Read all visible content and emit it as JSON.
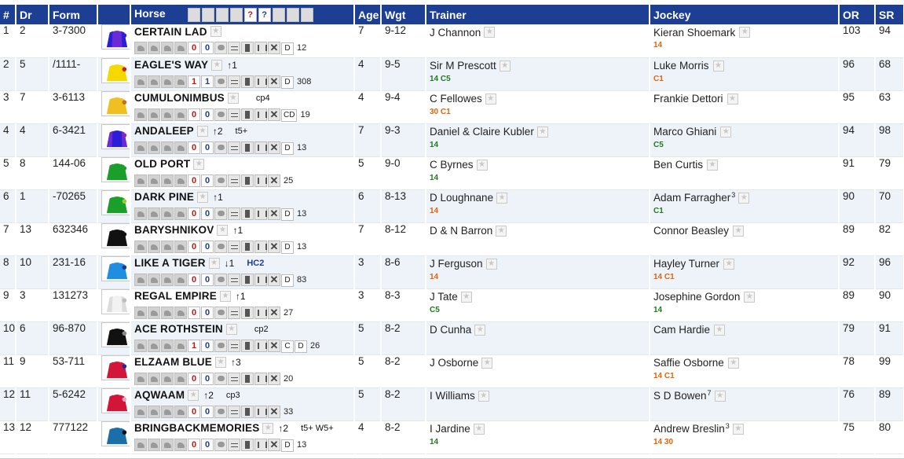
{
  "columns": {
    "num": "#",
    "dr": "Dr",
    "form": "Form",
    "horse": "Horse",
    "age": "Age",
    "wgt": "Wgt",
    "trainer": "Trainer",
    "jockey": "Jockey",
    "or": "OR",
    "sr": "SR"
  },
  "header_icons": {
    "q1": "?",
    "q2": "?"
  },
  "colors": {
    "header_bg": "#1c3f94",
    "row_alt_bg": "#eef3f9",
    "stat_green": "#1f7a1f",
    "stat_orange": "#e0650b",
    "count_red": "#c61616",
    "count_blue": "#1c3f94"
  },
  "runners": [
    {
      "num": "1",
      "dr": "2",
      "form": "3-7300",
      "name": "CERTAIN LAD",
      "trend": "",
      "tag": "",
      "c1": "0",
      "c2": "0",
      "code": "D",
      "rating": "12",
      "age": "7",
      "wgt": "9-12",
      "trainer": "J Channon",
      "trainer_claim": "",
      "trainer_stat": "",
      "jockey": "Kieran Shoemark",
      "jockey_claim": "",
      "jockey_stat": "14",
      "jockey_stat_color": "orange",
      "trainer_stat_color": "",
      "or": "103",
      "sr": "94",
      "silk": {
        "body": "#6a2bd6",
        "sleeve": "#2a1fd6",
        "cap": "#2a1fd6"
      }
    },
    {
      "num": "2",
      "dr": "5",
      "form": "/1111-",
      "name": "EAGLE'S WAY",
      "trend": "↑1",
      "tag": "",
      "c1": "1",
      "c2": "1",
      "code": "D",
      "rating": "308",
      "age": "4",
      "wgt": "9-5",
      "trainer": "Sir M Prescott",
      "trainer_claim": "",
      "trainer_stat": "14 C5",
      "trainer_stat_color": "green",
      "jockey": "Luke Morris",
      "jockey_claim": "",
      "jockey_stat": "C1",
      "jockey_stat_color": "orange",
      "or": "96",
      "sr": "68",
      "silk": {
        "body": "#f4d800",
        "sleeve": "#f4d800",
        "cap": "#d21c1c"
      }
    },
    {
      "num": "3",
      "dr": "7",
      "form": "3-6113",
      "name": "CUMULONIMBUS",
      "trend": "",
      "tag": "cp4",
      "c1": "0",
      "c2": "0",
      "code": "CD",
      "rating": "19",
      "age": "4",
      "wgt": "9-4",
      "trainer": "C Fellowes",
      "trainer_claim": "",
      "trainer_stat": "30 C1",
      "trainer_stat_color": "orange",
      "jockey": "Frankie Dettori",
      "jockey_claim": "",
      "jockey_stat": "",
      "jockey_stat_color": "",
      "or": "95",
      "sr": "63",
      "silk": {
        "body": "#f0c020",
        "sleeve": "#f0c020",
        "cap": "#b8741a"
      }
    },
    {
      "num": "4",
      "dr": "4",
      "form": "6-3421",
      "name": "ANDALEEP",
      "trend": "↑2",
      "tag": "t5+",
      "c1": "0",
      "c2": "0",
      "code": "D",
      "rating": "13",
      "age": "7",
      "wgt": "9-3",
      "trainer": "Daniel & Claire Kubler",
      "trainer_claim": "",
      "trainer_stat": "14",
      "trainer_stat_color": "green",
      "jockey": "Marco Ghiani",
      "jockey_claim": "",
      "jockey_stat": "C5",
      "jockey_stat_color": "green",
      "or": "94",
      "sr": "98",
      "silk": {
        "body": "#2a1fd6",
        "sleeve": "#6a2bd6",
        "cap": "#9b1fa8"
      }
    },
    {
      "num": "5",
      "dr": "8",
      "form": "144-06",
      "name": "OLD PORT",
      "trend": "",
      "tag": "",
      "c1": "0",
      "c2": "0",
      "code": "",
      "rating": "25",
      "age": "5",
      "wgt": "9-0",
      "trainer": "C Byrnes",
      "trainer_claim": "",
      "trainer_stat": "14",
      "trainer_stat_color": "green",
      "jockey": "Ben Curtis",
      "jockey_claim": "",
      "jockey_stat": "",
      "jockey_stat_color": "",
      "or": "91",
      "sr": "79",
      "silk": {
        "body": "#1aa02a",
        "sleeve": "#1aa02a",
        "cap": "#1aa02a"
      }
    },
    {
      "num": "6",
      "dr": "1",
      "form": "-70265",
      "name": "DARK PINE",
      "trend": "↑1",
      "tag": "",
      "c1": "0",
      "c2": "0",
      "code": "D",
      "rating": "13",
      "age": "6",
      "wgt": "8-13",
      "trainer": "D Loughnane",
      "trainer_claim": "",
      "trainer_stat": "14",
      "trainer_stat_color": "orange",
      "jockey": "Adam Farragher",
      "jockey_claim": "3",
      "jockey_stat": "C1",
      "jockey_stat_color": "green",
      "or": "90",
      "sr": "70",
      "silk": {
        "body": "#1aa02a",
        "sleeve": "#1aa02a",
        "cap": "#8fd12a"
      }
    },
    {
      "num": "7",
      "dr": "13",
      "form": "632346",
      "name": "BARYSHNIKOV",
      "trend": "↑1",
      "tag": "",
      "c1": "0",
      "c2": "0",
      "code": "D",
      "rating": "13",
      "age": "7",
      "wgt": "8-12",
      "trainer": "D & N Barron",
      "trainer_claim": "",
      "trainer_stat": "",
      "trainer_stat_color": "",
      "jockey": "Connor Beasley",
      "jockey_claim": "",
      "jockey_stat": "",
      "jockey_stat_color": "",
      "or": "89",
      "sr": "82",
      "silk": {
        "body": "#111111",
        "sleeve": "#111111",
        "cap": "#111111"
      }
    },
    {
      "num": "8",
      "dr": "10",
      "form": "231-16",
      "name": "LIKE A TIGER",
      "trend": "↓1",
      "tag": "HC2",
      "tag_blue": true,
      "c1": "0",
      "c2": "0",
      "code": "D",
      "rating": "83",
      "age": "3",
      "wgt": "8-6",
      "trainer": "J Ferguson",
      "trainer_claim": "",
      "trainer_stat": "14",
      "trainer_stat_color": "orange",
      "jockey": "Hayley Turner",
      "jockey_claim": "",
      "jockey_stat": "14 C1",
      "jockey_stat_color": "orange",
      "or": "92",
      "sr": "96",
      "silk": {
        "body": "#1f8ee0",
        "sleeve": "#1f8ee0",
        "cap": "#0f3f8a"
      }
    },
    {
      "num": "9",
      "dr": "3",
      "form": "131273",
      "name": "REGAL EMPIRE",
      "trend": "↑1",
      "tag": "",
      "c1": "0",
      "c2": "0",
      "code": "",
      "rating": "27",
      "age": "3",
      "wgt": "8-3",
      "trainer": "J Tate",
      "trainer_claim": "",
      "trainer_stat": "C5",
      "trainer_stat_color": "green",
      "jockey": "Josephine Gordon",
      "jockey_claim": "",
      "jockey_stat": "14",
      "jockey_stat_color": "green",
      "or": "89",
      "sr": "90",
      "silk": {
        "body": "#f2f2f2",
        "sleeve": "#dcdcdc",
        "cap": "#bdbdbd"
      }
    },
    {
      "num": "10",
      "dr": "6",
      "form": "96-870",
      "name": "ACE ROTHSTEIN",
      "trend": "",
      "tag": "cp2",
      "c1": "1",
      "c2": "0",
      "code": "C D",
      "rating": "26",
      "age": "5",
      "wgt": "8-2",
      "trainer": "D Cunha",
      "trainer_claim": "",
      "trainer_stat": "",
      "trainer_stat_color": "",
      "jockey": "Cam Hardie",
      "jockey_claim": "",
      "jockey_stat": "",
      "jockey_stat_color": "",
      "or": "79",
      "sr": "91",
      "silk": {
        "body": "#111111",
        "sleeve": "#111111",
        "cap": "#8a8a8a"
      }
    },
    {
      "num": "11",
      "dr": "9",
      "form": "53-711",
      "name": "ELZAAM BLUE",
      "trend": "↑3",
      "tag": "",
      "c1": "0",
      "c2": "0",
      "code": "",
      "rating": "20",
      "age": "5",
      "wgt": "8-2",
      "trainer": "J Osborne",
      "trainer_claim": "",
      "trainer_stat": "",
      "trainer_stat_color": "",
      "jockey": "Saffie Osborne",
      "jockey_claim": "",
      "jockey_stat": "14 C1",
      "jockey_stat_color": "orange",
      "or": "78",
      "sr": "99",
      "silk": {
        "body": "#d2163a",
        "sleeve": "#d2163a",
        "cap": "#1d2aa8"
      }
    },
    {
      "num": "12",
      "dr": "11",
      "form": "5-6242",
      "name": "AQWAAM",
      "trend": "↑2",
      "tag": "cp3",
      "c1": "0",
      "c2": "0",
      "code": "",
      "rating": "33",
      "age": "5",
      "wgt": "8-2",
      "trainer": "I Williams",
      "trainer_claim": "",
      "trainer_stat": "",
      "trainer_stat_color": "",
      "jockey": "S D Bowen",
      "jockey_claim": "7",
      "jockey_stat": "",
      "jockey_stat_color": "",
      "or": "76",
      "sr": "89",
      "silk": {
        "body": "#d2163a",
        "sleeve": "#d2163a",
        "cap": "#f2a0c8"
      }
    },
    {
      "num": "13",
      "dr": "12",
      "form": "777122",
      "name": "BRINGBACKMEMORIES",
      "trend": "↑2",
      "tag": "t5+ W5+",
      "c1": "0",
      "c2": "0",
      "code": "D",
      "rating": "13",
      "age": "4",
      "wgt": "8-2",
      "trainer": "I Jardine",
      "trainer_claim": "",
      "trainer_stat": "14",
      "trainer_stat_color": "green",
      "jockey": "Andrew Breslin",
      "jockey_claim": "3",
      "jockey_stat": "14 30",
      "jockey_stat_color": "orange",
      "or": "75",
      "sr": "80",
      "silk": {
        "body": "#1a6fa8",
        "sleeve": "#1a6fa8",
        "cap": "#111111"
      }
    }
  ]
}
